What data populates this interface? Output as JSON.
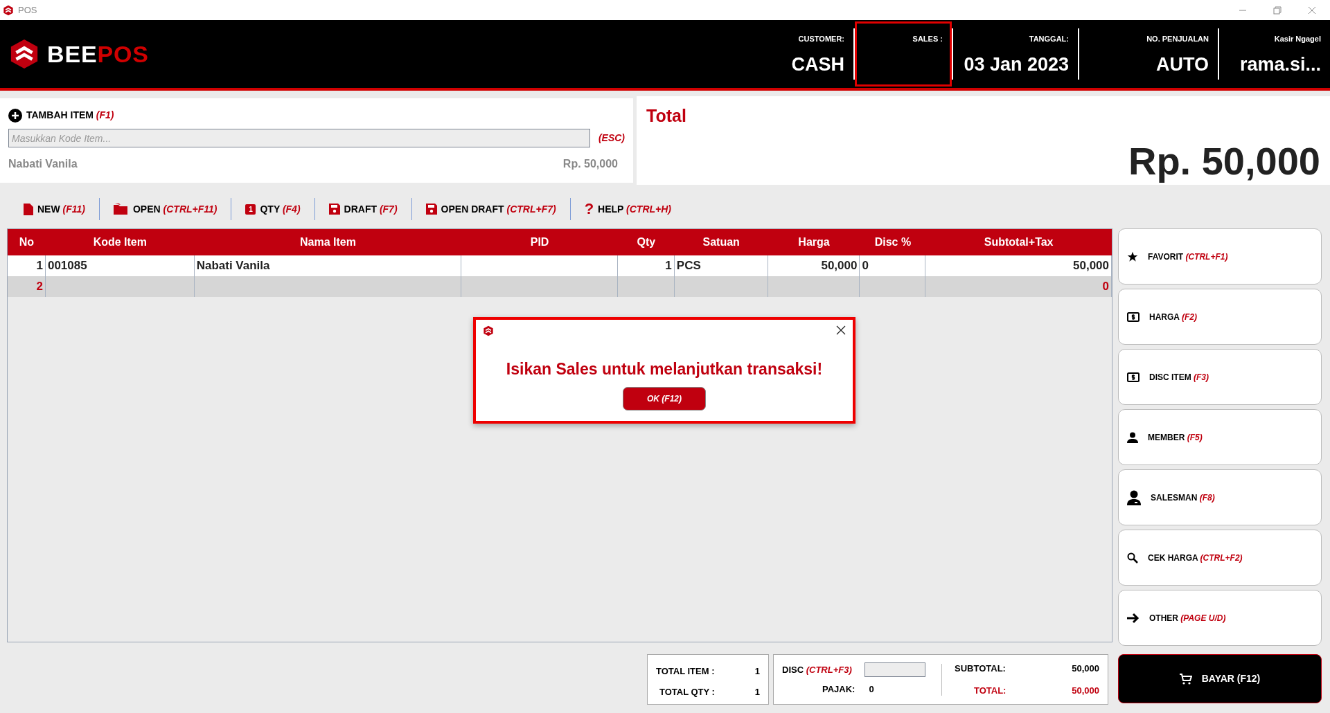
{
  "window": {
    "title": "POS"
  },
  "header": {
    "logo": {
      "part1": "BEE",
      "part2": "POS"
    },
    "fields": [
      {
        "label": "CUSTOMER:",
        "value": "CASH",
        "highlighted": false
      },
      {
        "label": "SALES :",
        "highlighted": true
      },
      {
        "label": "TANGGAL:",
        "value": "03 Jan 2023",
        "highlighted": false
      },
      {
        "label": "NO. PENJUALAN",
        "value": "AUTO",
        "highlighted": false
      },
      {
        "label": "Kasir Ngagel",
        "value": "rama.si...",
        "highlighted": false
      }
    ]
  },
  "add_item": {
    "title": "TAMBAH ITEM",
    "shortcut": "(F1)",
    "placeholder": "Masukkan Kode Item...",
    "field_shortcut": "(ESC)",
    "last_item": "Nabati Vanila",
    "last_price": "Rp. 50,000"
  },
  "total": {
    "label": "Total",
    "amount": "Rp. 50,000"
  },
  "toolbar": [
    {
      "kind": "new",
      "label": "NEW",
      "shortcut": "(F11)"
    },
    {
      "kind": "open",
      "label": "OPEN",
      "shortcut": "(CTRL+F11)"
    },
    {
      "kind": "qty",
      "label": "QTY",
      "shortcut": "(F4)",
      "badge": "1"
    },
    {
      "kind": "save",
      "label": "DRAFT",
      "shortcut": "(F7)"
    },
    {
      "kind": "save",
      "label": "OPEN DRAFT",
      "shortcut": "(CTRL+F7)"
    },
    {
      "kind": "help",
      "label": "HELP",
      "shortcut": "(CTRL+H)",
      "glyph": "?"
    }
  ],
  "table": {
    "columns": [
      "No",
      "Kode Item",
      "Nama Item",
      "PID",
      "Qty",
      "Satuan",
      "Harga",
      "Disc %",
      "Subtotal+Tax"
    ],
    "rows": [
      {
        "selected": false,
        "cells": [
          "1",
          "001085",
          "Nabati Vanila",
          "",
          "1",
          "PCS",
          "50,000",
          "0",
          "50,000"
        ]
      },
      {
        "selected": true,
        "cells": [
          "2",
          "",
          "",
          "",
          "",
          "",
          "",
          "",
          "0"
        ]
      }
    ]
  },
  "side_buttons": [
    {
      "kind": "star",
      "label": "FAVORIT",
      "shortcut": "(CTRL+F1)"
    },
    {
      "kind": "money",
      "label": "HARGA",
      "shortcut": "(F2)"
    },
    {
      "kind": "money",
      "label": "DISC ITEM",
      "shortcut": "(F3)"
    },
    {
      "kind": "person",
      "label": "MEMBER",
      "shortcut": "(F5)"
    },
    {
      "kind": "salesman",
      "label": "SALESMAN",
      "shortcut": "(F8)"
    },
    {
      "kind": "search",
      "label": "CEK HARGA",
      "shortcut": "(CTRL+F2)"
    },
    {
      "kind": "arrow",
      "label": "OTHER",
      "shortcut": "(PAGE U/D)"
    }
  ],
  "summary": {
    "total_item_label": "TOTAL ITEM :",
    "total_item": "1",
    "total_qty_label": "TOTAL QTY :",
    "total_qty": "1",
    "disc_label": "DISC",
    "disc_shortcut": "(CTRL+F3)",
    "pajak_label": "PAJAK:",
    "pajak": "0",
    "subtotal_label": "SUBTOTAL:",
    "subtotal": "50,000",
    "total_label": "TOTAL:",
    "total": "50,000"
  },
  "pay_button": {
    "label": "BAYAR (F12)"
  },
  "dialog": {
    "message": "Isikan Sales untuk melanjutkan transaksi!",
    "button": "OK (F12)"
  }
}
